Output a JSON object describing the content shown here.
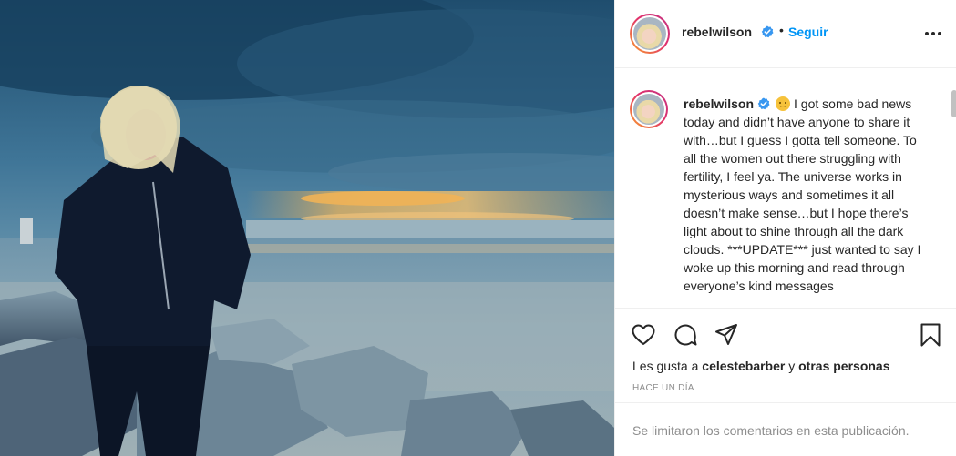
{
  "post": {
    "author": {
      "username": "rebelwilson",
      "verified": true
    },
    "header": {
      "dot": "•",
      "follow_label": "Seguir"
    },
    "caption": {
      "username": "rebelwilson",
      "emoji": "disappointed-face",
      "text": "I got some bad news today and didn’t have anyone to share it with…but I guess I gotta tell someone. To all the women out there struggling with fertility, I feel ya. The universe works in mysterious ways and sometimes it all doesn’t make sense…but I hope there’s light about to shine through all the dark clouds. ***UPDATE*** just wanted to say I woke up this morning and read through everyone’s kind messages"
    },
    "actions": {
      "icons": [
        "heart-icon",
        "comment-icon",
        "share-icon",
        "bookmark-icon"
      ]
    },
    "likes": {
      "prefix": "Les gusta a",
      "liker": "celestebarber",
      "connector": "y",
      "others": "otras personas"
    },
    "timestamp": "HACE UN DÍA",
    "comments_disabled": "Se limitaron los comentarios en esta publicación."
  },
  "colors": {
    "link_blue": "#0095f6",
    "verified_blue": "#3897f0",
    "text": "#262626",
    "muted": "#8e8e8e"
  }
}
